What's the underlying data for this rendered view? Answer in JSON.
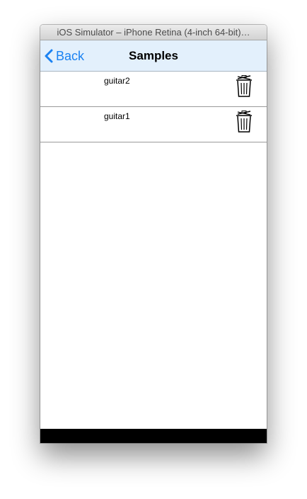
{
  "window": {
    "title": "iOS Simulator – iPhone Retina (4-inch 64-bit)…"
  },
  "navbar": {
    "back_label": "Back",
    "title": "Samples",
    "accent_color": "#1a82f2",
    "background_color": "#e3f0fc"
  },
  "samples": [
    {
      "name": "guitar2",
      "action_icon": "trash-icon"
    },
    {
      "name": "guitar1",
      "action_icon": "trash-icon"
    }
  ]
}
